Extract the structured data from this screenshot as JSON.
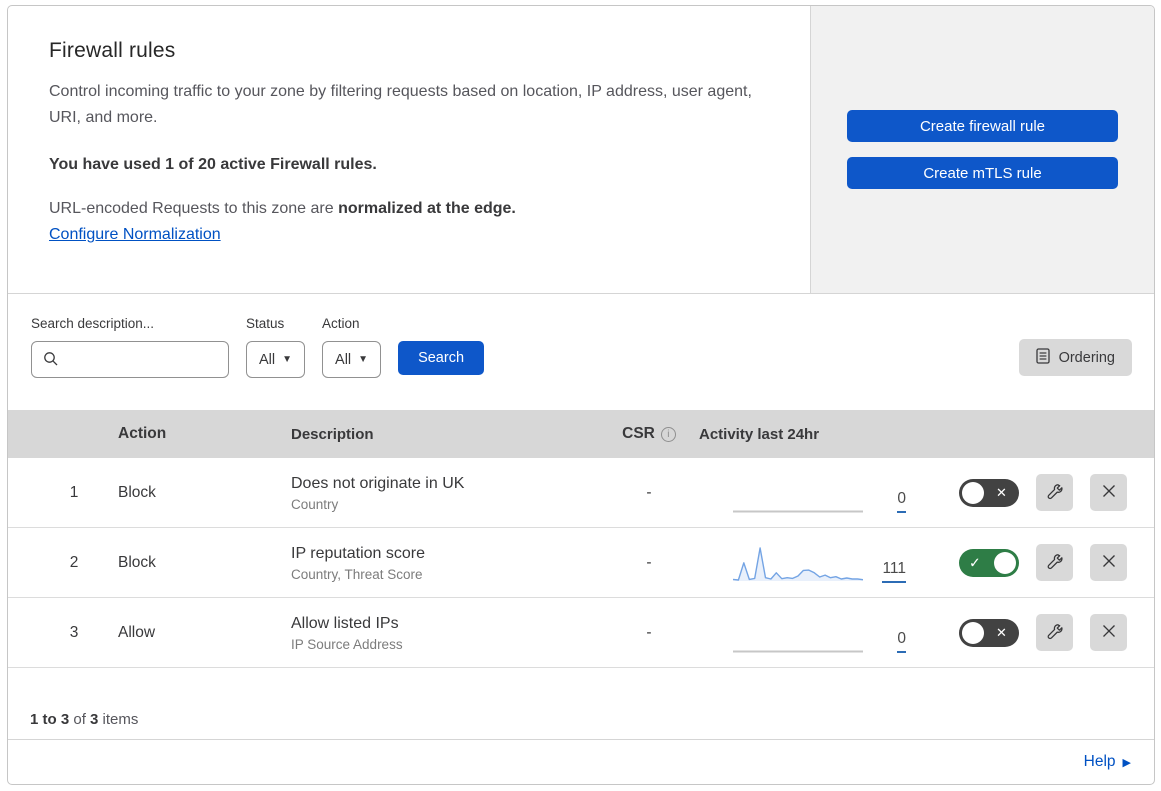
{
  "colors": {
    "accent_blue": "#0e57c9",
    "link_blue": "#0051c3",
    "toggle_on_green": "#2e7d46",
    "toggle_off_gray": "#424242",
    "sparkline_blue": "#74a4e4",
    "table_header_gray": "#d7d7d7",
    "panel_gray": "#f1f1f1",
    "button_gray": "#d9d9d9"
  },
  "header": {
    "title": "Firewall rules",
    "description": "Control incoming traffic to your zone by filtering requests based on location, IP address, user agent, URI, and more.",
    "usage_note": "You have used 1 of 20 active Firewall rules.",
    "normalization_prefix": "URL-encoded Requests to this zone are ",
    "normalization_bold": "normalized at the edge.",
    "normalization_link": "Configure Normalization",
    "create_firewall_button": "Create firewall rule",
    "create_mtls_button": "Create mTLS rule"
  },
  "filters": {
    "search_label": "Search description...",
    "search_value": "",
    "status_label": "Status",
    "status_value": "All",
    "action_label": "Action",
    "action_value": "All",
    "search_button": "Search",
    "ordering_button": "Ordering"
  },
  "table": {
    "columns": {
      "action": "Action",
      "description": "Description",
      "csr": "CSR",
      "activity": "Activity last 24hr"
    },
    "rows": [
      {
        "priority": "1",
        "action": "Block",
        "description": "Does not originate in UK",
        "fields": "Country",
        "csr": "-",
        "activity_count": "0",
        "enabled": false
      },
      {
        "priority": "2",
        "action": "Block",
        "description": "IP reputation score",
        "fields": "Country, Threat Score",
        "csr": "-",
        "activity_count": "111",
        "enabled": true
      },
      {
        "priority": "3",
        "action": "Allow",
        "description": "Allow listed IPs",
        "fields": "IP Source Address",
        "csr": "-",
        "activity_count": "0",
        "enabled": false
      }
    ]
  },
  "chart_data": {
    "type": "line",
    "title": "Activity last 24hr sparklines (relative request volume, unlabeled axes)",
    "xlabel": "",
    "ylabel": "",
    "ylim": [
      0,
      100
    ],
    "legend": false,
    "grid": false,
    "series": [
      {
        "name": "rule-1-activity",
        "total": 0,
        "values": [
          0,
          0,
          0,
          0,
          0,
          0,
          0,
          0,
          0,
          0,
          0,
          0,
          0,
          0,
          0,
          0,
          0,
          0,
          0,
          0,
          0,
          0,
          0,
          0,
          0
        ]
      },
      {
        "name": "rule-2-activity",
        "total": 111,
        "values": [
          5,
          3,
          55,
          5,
          8,
          100,
          10,
          6,
          25,
          7,
          10,
          8,
          15,
          32,
          33,
          25,
          12,
          18,
          10,
          13,
          6,
          9,
          6,
          6,
          4
        ]
      },
      {
        "name": "rule-3-activity",
        "total": 0,
        "values": [
          0,
          0,
          0,
          0,
          0,
          0,
          0,
          0,
          0,
          0,
          0,
          0,
          0,
          0,
          0,
          0,
          0,
          0,
          0,
          0,
          0,
          0,
          0,
          0,
          0
        ]
      }
    ]
  },
  "footer": {
    "range": "1 to 3",
    "of_text": " of ",
    "total": "3",
    "items_text": " items",
    "help": "Help"
  }
}
